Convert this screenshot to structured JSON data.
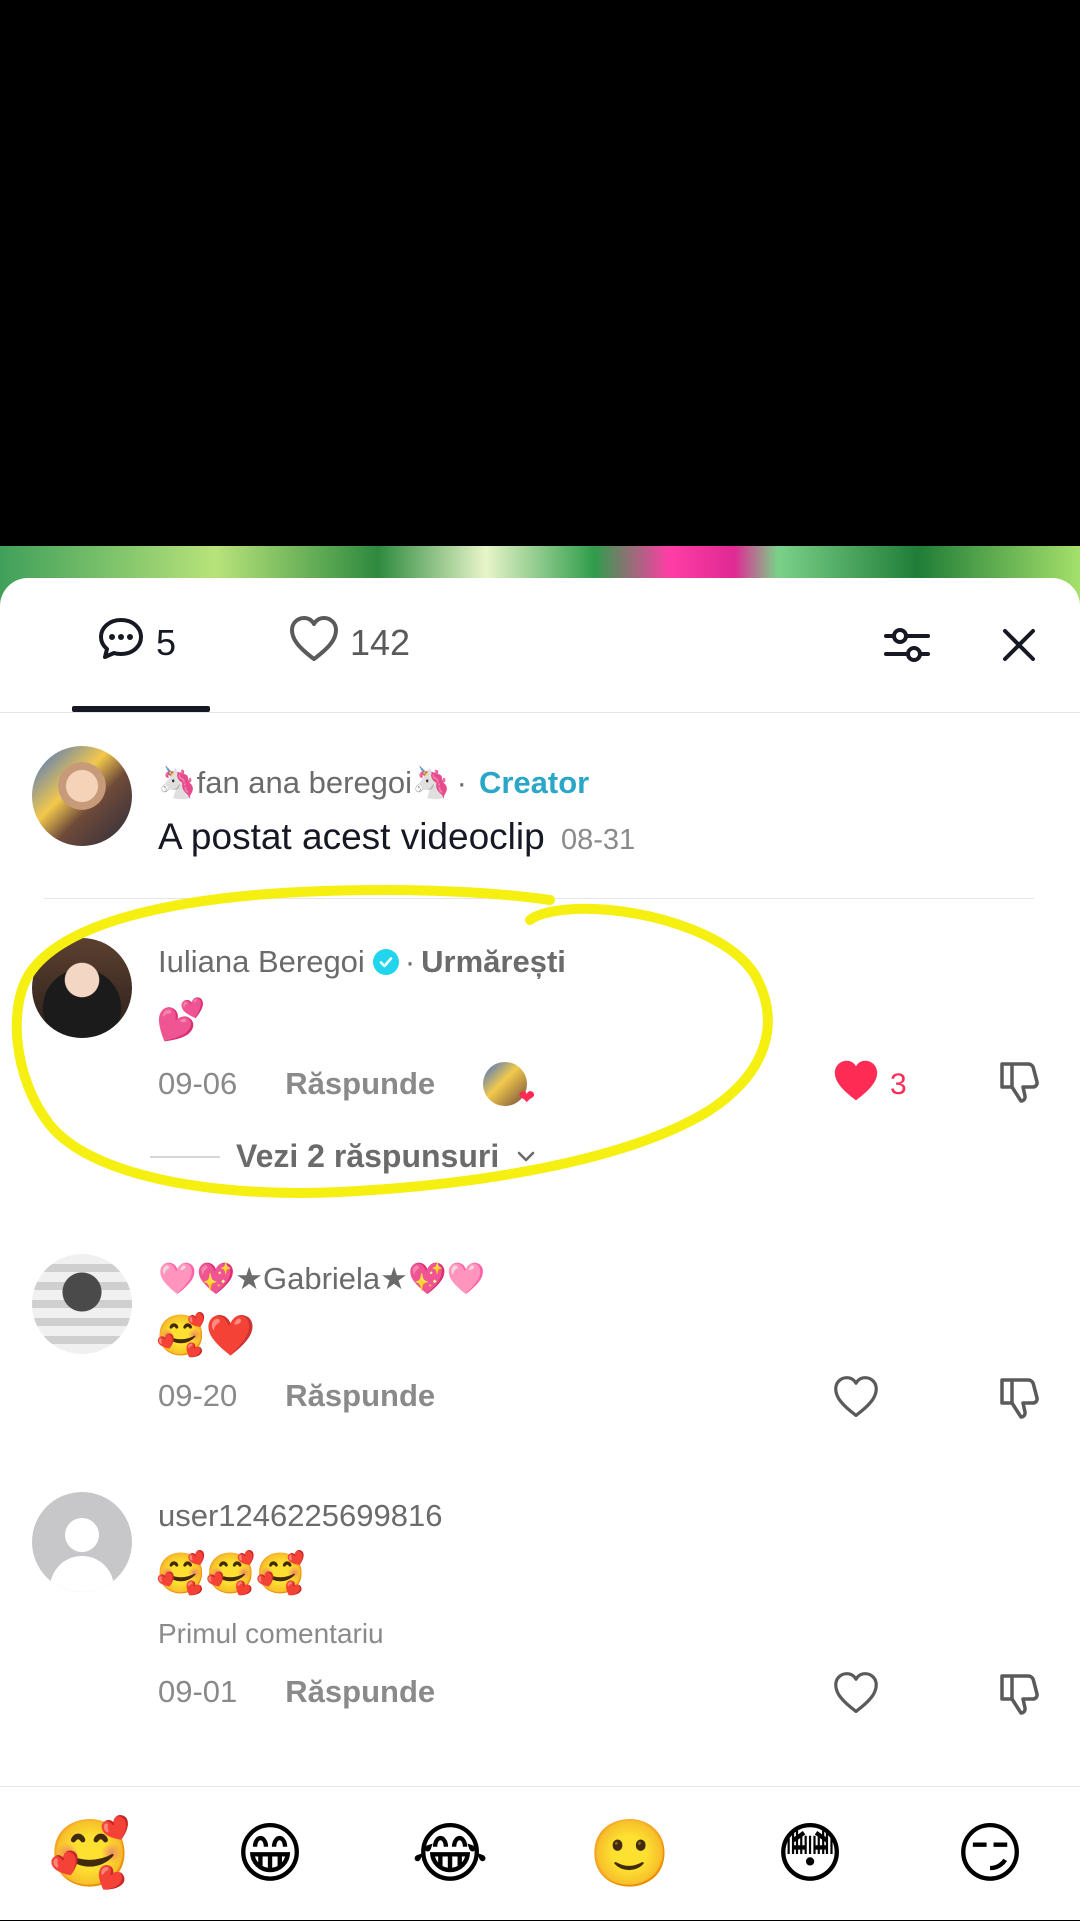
{
  "header": {
    "comments_count": "5",
    "likes_count": "142"
  },
  "creator_post": {
    "username": "🦄fan ana beregoi🦄",
    "separator": "·",
    "tag": "Creator",
    "text": "A postat acest videoclip",
    "date": "08-31"
  },
  "comments": [
    {
      "username": "Iuliana Beregoi",
      "verified": true,
      "separator": "·",
      "relation": "Urmărești",
      "text": "💕",
      "date": "09-06",
      "reply_label": "Răspunde",
      "liked_by_creator": true,
      "liked": true,
      "like_count": "3",
      "view_replies_label": "Vezi 2 răspunsuri"
    },
    {
      "username": "🩷💖★Gabriela★💖🩷",
      "text": "🥰❤️",
      "date": "09-20",
      "reply_label": "Răspunde",
      "liked": false
    },
    {
      "username": "user1246225699816",
      "text": "🥰🥰🥰",
      "badge": "Primul comentariu",
      "date": "09-01",
      "reply_label": "Răspunde",
      "liked": false
    }
  ],
  "emoji_bar": [
    "🥰",
    "😁",
    "😂",
    "🙂",
    "😳",
    "😏"
  ],
  "colors": {
    "accent_creator": "#2aa6c9",
    "like_red": "#fe2c55",
    "verified_blue": "#20d5ec",
    "highlight_yellow": "#f5f011"
  },
  "icons": {
    "comments": "comment-bubble-icon",
    "likes": "heart-outline-icon",
    "filter": "filter-sliders-icon",
    "close": "close-icon",
    "dislike": "thumbs-down-icon"
  }
}
